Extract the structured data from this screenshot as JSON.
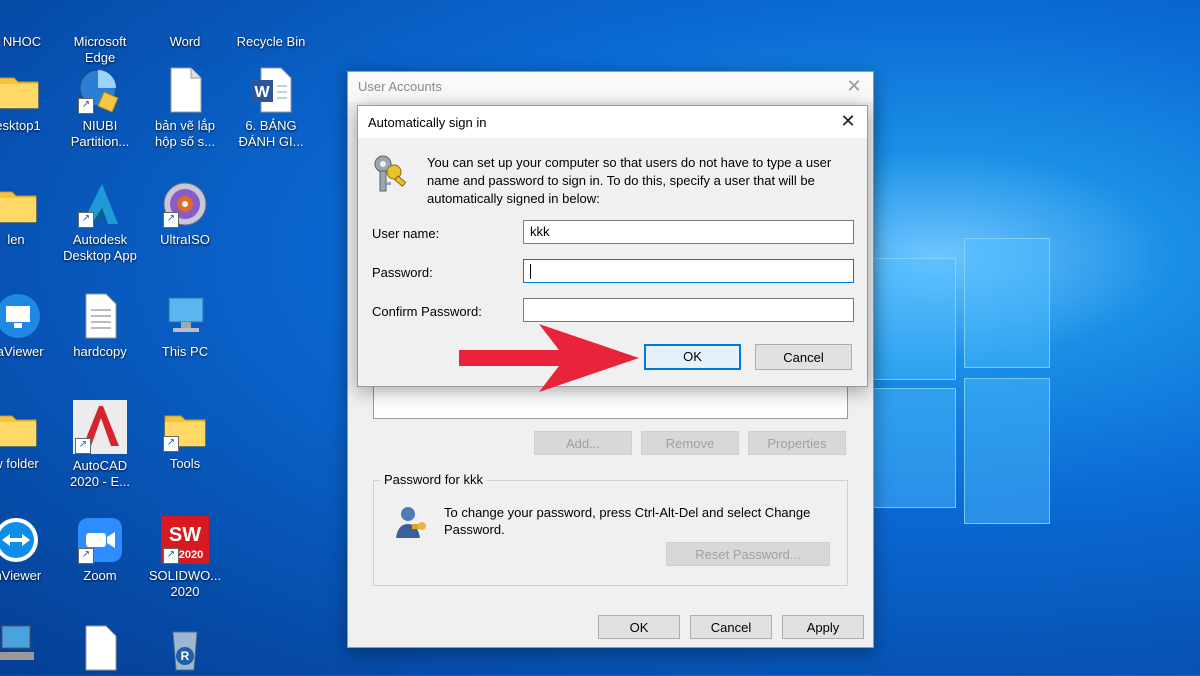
{
  "desktop": {
    "icons": [
      {
        "label": "NHOC",
        "icon": "folder-icon"
      },
      {
        "label": "Microsoft\nEdge",
        "icon": "edge-icon"
      },
      {
        "label": "Word",
        "icon": "word-icon"
      },
      {
        "label": "Recycle Bin",
        "icon": "recycle-bin-icon"
      },
      {
        "label": "esktop1",
        "icon": "folder-icon"
      },
      {
        "label": "NIUBI\nPartition...",
        "icon": "niubi-icon"
      },
      {
        "label": "bản vẽ lắp\nhộp số s...",
        "icon": "document-icon"
      },
      {
        "label": "6. BẢNG\nĐÁNH GI...",
        "icon": "word-doc-icon"
      },
      {
        "label": "len",
        "icon": "folder-icon"
      },
      {
        "label": "Autodesk\nDesktop App",
        "icon": "autodesk-icon"
      },
      {
        "label": "UltraISO",
        "icon": "disc-icon"
      },
      {
        "label": "raViewer",
        "icon": "viewer-icon"
      },
      {
        "label": "hardcopy",
        "icon": "text-file-icon"
      },
      {
        "label": "This PC",
        "icon": "computer-icon"
      },
      {
        "label": "w folder",
        "icon": "folder-icon"
      },
      {
        "label": "AutoCAD\n2020 - E...",
        "icon": "autocad-icon"
      },
      {
        "label": "Tools",
        "icon": "folder-icon"
      },
      {
        "label": "mViewer",
        "icon": "teamviewer-icon"
      },
      {
        "label": "Zoom",
        "icon": "zoom-icon"
      },
      {
        "label": "SOLIDWO...\n2020",
        "icon": "solidworks-icon"
      }
    ]
  },
  "user_accounts": {
    "title": "User Accounts",
    "add_label": "Add...",
    "remove_label": "Remove",
    "properties_label": "Properties",
    "password_group_label": "Password for kkk",
    "password_info": "To change your password, press Ctrl-Alt-Del and select Change Password.",
    "reset_password_label": "Reset Password...",
    "ok_label": "OK",
    "cancel_label": "Cancel",
    "apply_label": "Apply"
  },
  "autosign": {
    "title": "Automatically sign in",
    "description": "You can set up your computer so that users do not have to type a user name and password to sign in. To do this, specify a user that will be automatically signed in below:",
    "username_label": "User name:",
    "username_value": "kkk",
    "password_label": "Password:",
    "password_value": "",
    "confirm_label": "Confirm Password:",
    "confirm_value": "",
    "ok_label": "OK",
    "cancel_label": "Cancel"
  },
  "colors": {
    "annotation_arrow": "#e8233a",
    "focus_blue": "#0078d7"
  }
}
